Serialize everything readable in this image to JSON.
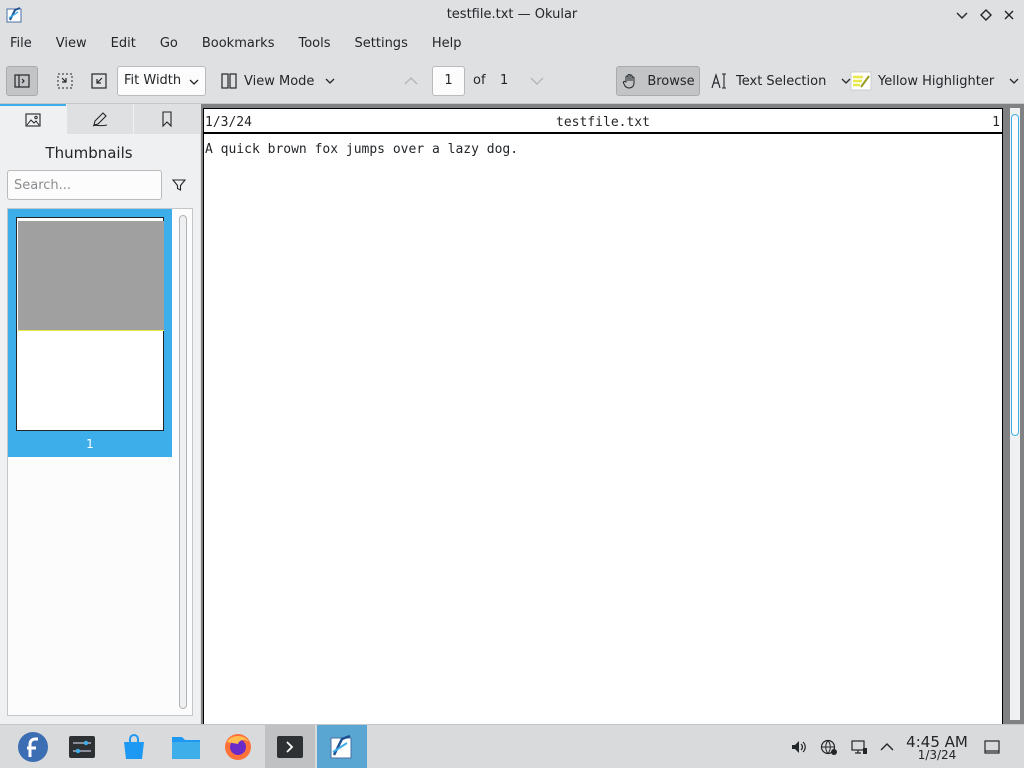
{
  "window": {
    "title": "testfile.txt — Okular"
  },
  "menubar": [
    "File",
    "Edit",
    "Go",
    "Bookmarks",
    "Tools",
    "Settings",
    "Help"
  ],
  "menubar_view": "View",
  "toolbar": {
    "zoom_value": "Fit Width",
    "view_mode_label": "View Mode",
    "page_current": "1",
    "page_of": "of",
    "page_total": "1",
    "browse_label": "Browse",
    "text_selection_label": "Text Selection",
    "highlighter_label": "Yellow Highlighter"
  },
  "sidebar": {
    "title": "Thumbnails",
    "search_placeholder": "Search...",
    "thumbnail_page_number": "1"
  },
  "document": {
    "header_left": "1/3/24",
    "header_center": "testfile.txt",
    "header_right": "1",
    "body": "A quick brown fox jumps over a lazy dog."
  },
  "taskbar": {
    "time": "4:45 AM",
    "date": "1/3/24"
  },
  "colors": {
    "accent": "#3daee9",
    "taskbar_active": "#5aa6d3",
    "highlighter": "#e8e84a"
  }
}
